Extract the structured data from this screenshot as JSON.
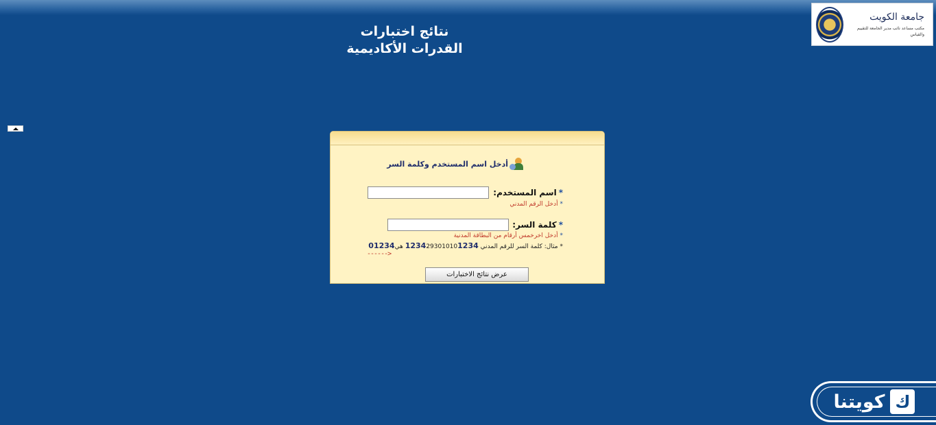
{
  "page": {
    "title_line1": "نتائج اختبارات",
    "title_line2": "القدرات الأكاديمية"
  },
  "logo": {
    "name": "جامعة الكويت",
    "subtitle": "مكتب مساعد نائب مدير الجامعة للتقييم والقياس"
  },
  "login": {
    "header": "أدخل اسم المستخدم وكلمة السر",
    "star": "*",
    "username_label": "اسم المستخدم:",
    "username_hint": "أدخل الرقم المدني",
    "username_value": "",
    "password_label": "كلمة السر:",
    "password_hint": "أدخل اخرخمس أرقام من البطاقة المدنية",
    "password_value": "",
    "example_prefix": "مثال: كلمة السر للرقم المدني",
    "example_civil_bold": "1234",
    "example_civil_middle": "29301010",
    "example_civil_tail": "1234",
    "example_is": "هي",
    "example_password": "01234",
    "example_arrow": "------>",
    "submit_label": "عرض نتائج الاختبارات"
  },
  "brand": {
    "name": "كويتنا",
    "mark": "ك"
  },
  "colors": {
    "background": "#0f4a8a",
    "panel": "#fff3c4",
    "hint": "#c0392b"
  }
}
